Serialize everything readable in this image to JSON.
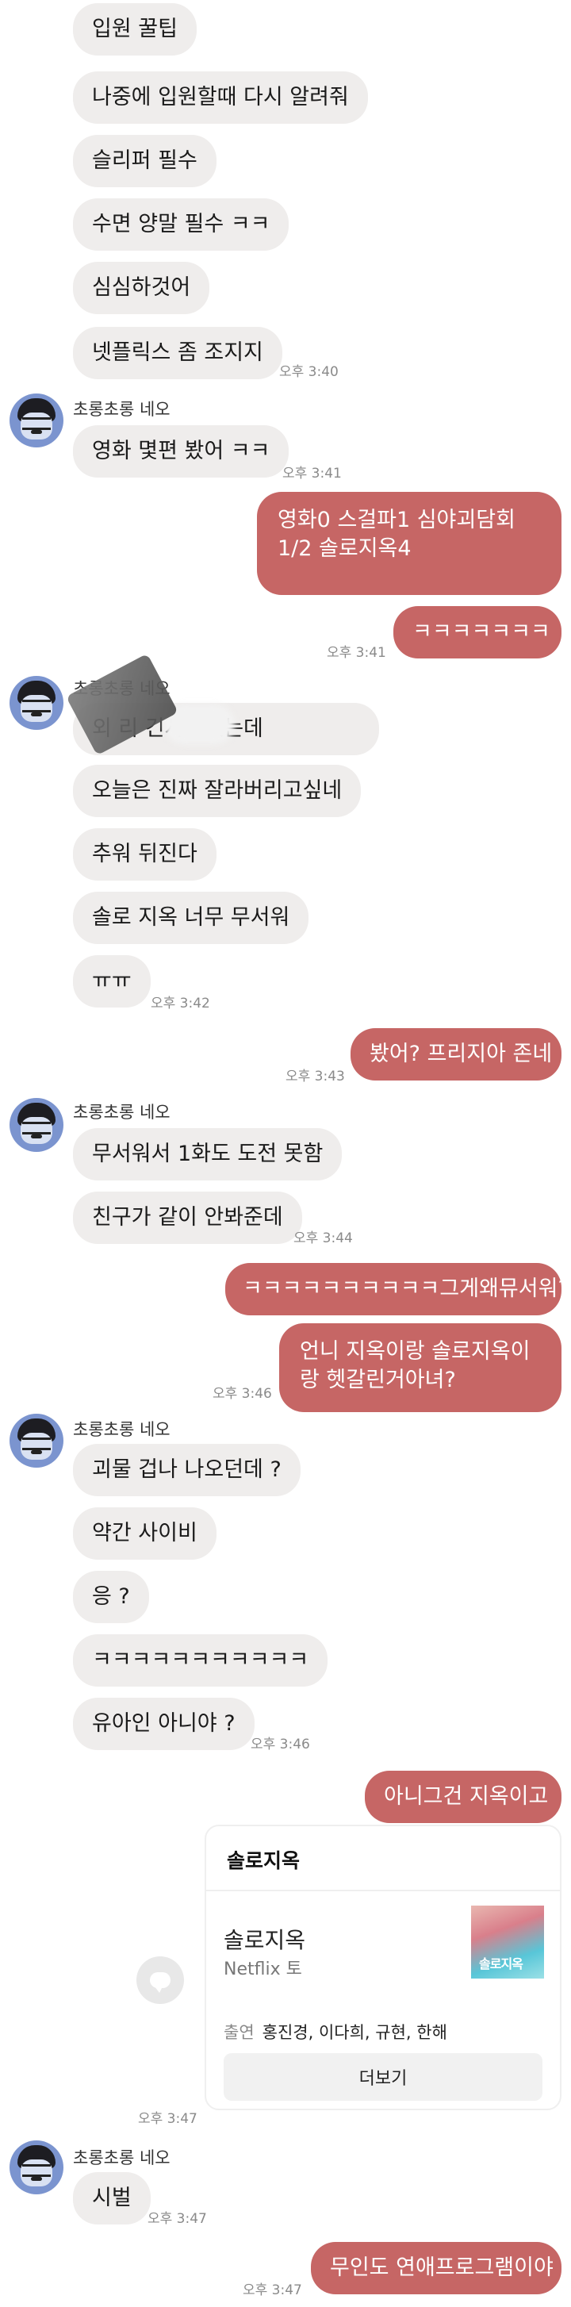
{
  "sender_name": "초롱초롱 네오",
  "messages": {
    "m1": "입원 꿀팁",
    "m2": "나중에 입원할때 다시 알려줘",
    "m3": "슬리퍼 필수",
    "m4": "수면 양말 필수 ㅋㅋ",
    "m5": "심심하것어",
    "m6": "넷플릭스 좀 조지지",
    "t1": "오후 3:40",
    "m7": "영화 몇편 봤어 ㅋㅋ",
    "t2": "오후 3:41",
    "m8": "영화0 스걸파1 심야괴담회1/2 솔로지옥4",
    "m9": "ㅋㅋㅋㅋㅋㅋㅋ",
    "t3": "오후 3:41",
    "m10": "외                  리 긴사람있는데",
    "m11": "오늘은 진짜 잘라버리고싶네",
    "m12": "추워 뒤진다",
    "m13": "솔로 지옥 너무 무서워",
    "m14": "ㅠㅠ",
    "t4": "오후 3:42",
    "m15": "봤어? 프리지아 존네",
    "t5": "오후 3:43",
    "m16": "무서워서 1화도 도전 못함",
    "m17": "친구가 같이 안봐준데",
    "t6": "오후 3:44",
    "m18": "ㅋㅋㅋㅋㅋㅋㅋㅋㅋㅋ그게왜뮤서워?",
    "m19": "언니 지옥이랑 솔로지옥이랑 헷갈린거아녀?",
    "t7": "오후 3:46",
    "m20": "괴물 겁나 나오던데 ?",
    "m21": "약간 사이비",
    "m22": "응 ?",
    "m23": "ㅋㅋㅋㅋㅋㅋㅋㅋㅋㅋㅋ",
    "m24": "유아인 아니야 ?",
    "t8": "오후 3:46",
    "m25": "아니그건 지옥이고",
    "t9": "오후 3:47",
    "m26": "시벌",
    "t10": "오후 3:47",
    "m27": "무인도 연애프로그램이야",
    "t11": "오후 3:47"
  },
  "card": {
    "title": "솔로지옥",
    "name": "솔로지옥",
    "sub": "Netflix 토",
    "thumb_text": "솔로지옥",
    "cast_label": "출연",
    "cast": "홍진경, 이다희, 규현, 한해",
    "button": "더보기"
  },
  "colors": {
    "received_bubble": "#efedec",
    "sent_bubble": "#c66665",
    "avatar_bg": "#7b94cf"
  }
}
